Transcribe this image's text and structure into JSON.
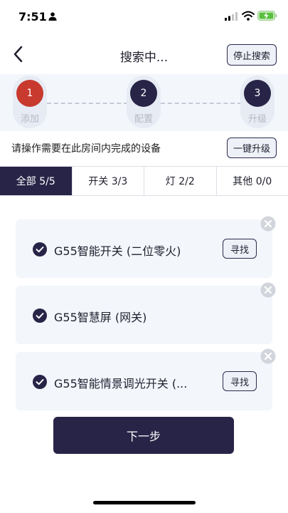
{
  "status_bar": {
    "time": "7:51"
  },
  "nav": {
    "title": "搜索中...",
    "stop_label": "停止搜索"
  },
  "steps": [
    {
      "number": "1",
      "label": "添加"
    },
    {
      "number": "2",
      "label": "配置"
    },
    {
      "number": "3",
      "label": "升级"
    }
  ],
  "instruction": {
    "text": "请操作需要在此房间内完成的设备",
    "upgrade_label": "一键升级"
  },
  "tabs": [
    {
      "label": "全部 5/5"
    },
    {
      "label": "开关 3/3"
    },
    {
      "label": "灯 2/2"
    },
    {
      "label": "其他 0/0"
    }
  ],
  "devices": [
    {
      "name": "G55智能开关 (二位零火)",
      "find_label": "寻找"
    },
    {
      "name": "G55智慧屏 (网关)"
    },
    {
      "name": "G55智能情景调光开关 (...",
      "find_label": "寻找"
    }
  ],
  "next_label": "下一步",
  "colors": {
    "primary": "#272447",
    "active_step": "#c8392e",
    "card_bg": "#f3f6fb"
  }
}
